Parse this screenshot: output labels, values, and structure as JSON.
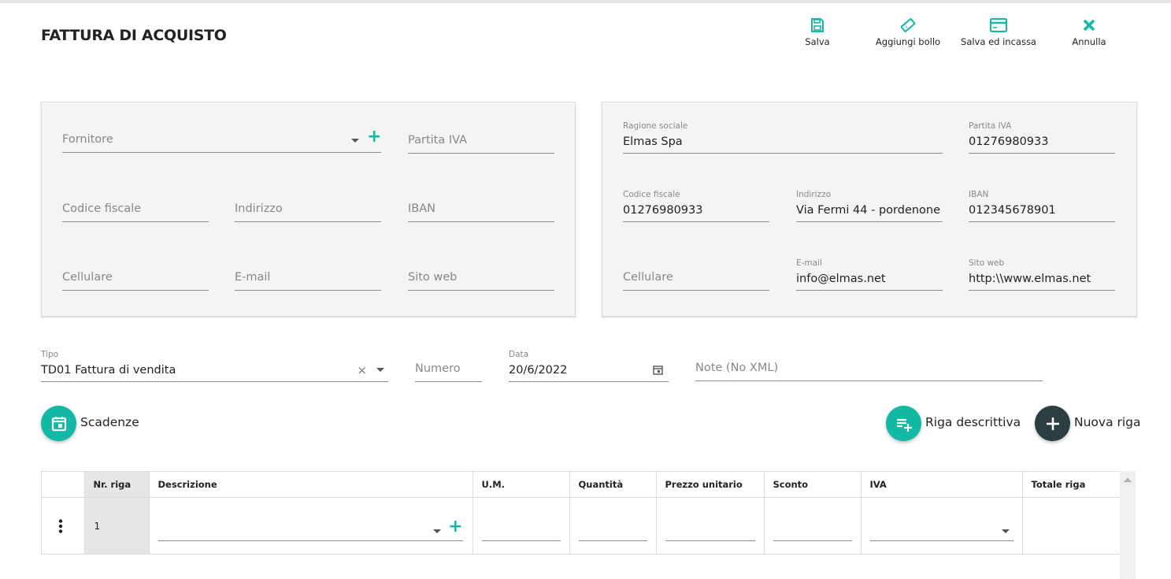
{
  "page": {
    "title": "FATTURA DI ACQUISTO"
  },
  "toolbar": {
    "save": "Salva",
    "add_stamp": "Aggiungi bollo",
    "save_collect": "Salva ed incassa",
    "cancel": "Annulla"
  },
  "supplier": {
    "fornitore_placeholder": "Fornitore",
    "partita_iva_placeholder": "Partita IVA",
    "codice_fiscale_placeholder": "Codice fiscale",
    "indirizzo_placeholder": "Indirizzo",
    "iban_placeholder": "IBAN",
    "cellulare_placeholder": "Cellulare",
    "email_placeholder": "E-mail",
    "sito_web_placeholder": "Sito web"
  },
  "company": {
    "ragione_sociale_label": "Ragione sociale",
    "ragione_sociale": "Elmas Spa",
    "partita_iva_label": "Partita IVA",
    "partita_iva": "01276980933",
    "codice_fiscale_label": "Codice fiscale",
    "codice_fiscale": "01276980933",
    "indirizzo_label": "Indirizzo",
    "indirizzo": "Via Fermi 44 - pordenone",
    "iban_label": "IBAN",
    "iban": "012345678901",
    "cellulare_placeholder": "Cellulare",
    "email_label": "E-mail",
    "email": "info@elmas.net",
    "sito_web_label": "Sito web",
    "sito_web": "http:\\\\www.elmas.net"
  },
  "document": {
    "tipo_label": "Tipo",
    "tipo": "TD01 Fattura di vendita",
    "numero_placeholder": "Numero",
    "data_label": "Data",
    "data": "20/6/2022",
    "note_placeholder": "Note (No XML)"
  },
  "actions": {
    "scadenze": "Scadenze",
    "riga_descrittiva": "Riga descrittiva",
    "nuova_riga": "Nuova riga"
  },
  "grid": {
    "columns": [
      "Nr. riga",
      "Descrizione",
      "U.M.",
      "Quantità",
      "Prezzo unitario",
      "Sconto",
      "IVA",
      "Totale riga"
    ],
    "rows": [
      {
        "nr": "1"
      }
    ]
  },
  "colors": {
    "accent": "#13b9a5",
    "dark_button": "#2b3e40"
  }
}
